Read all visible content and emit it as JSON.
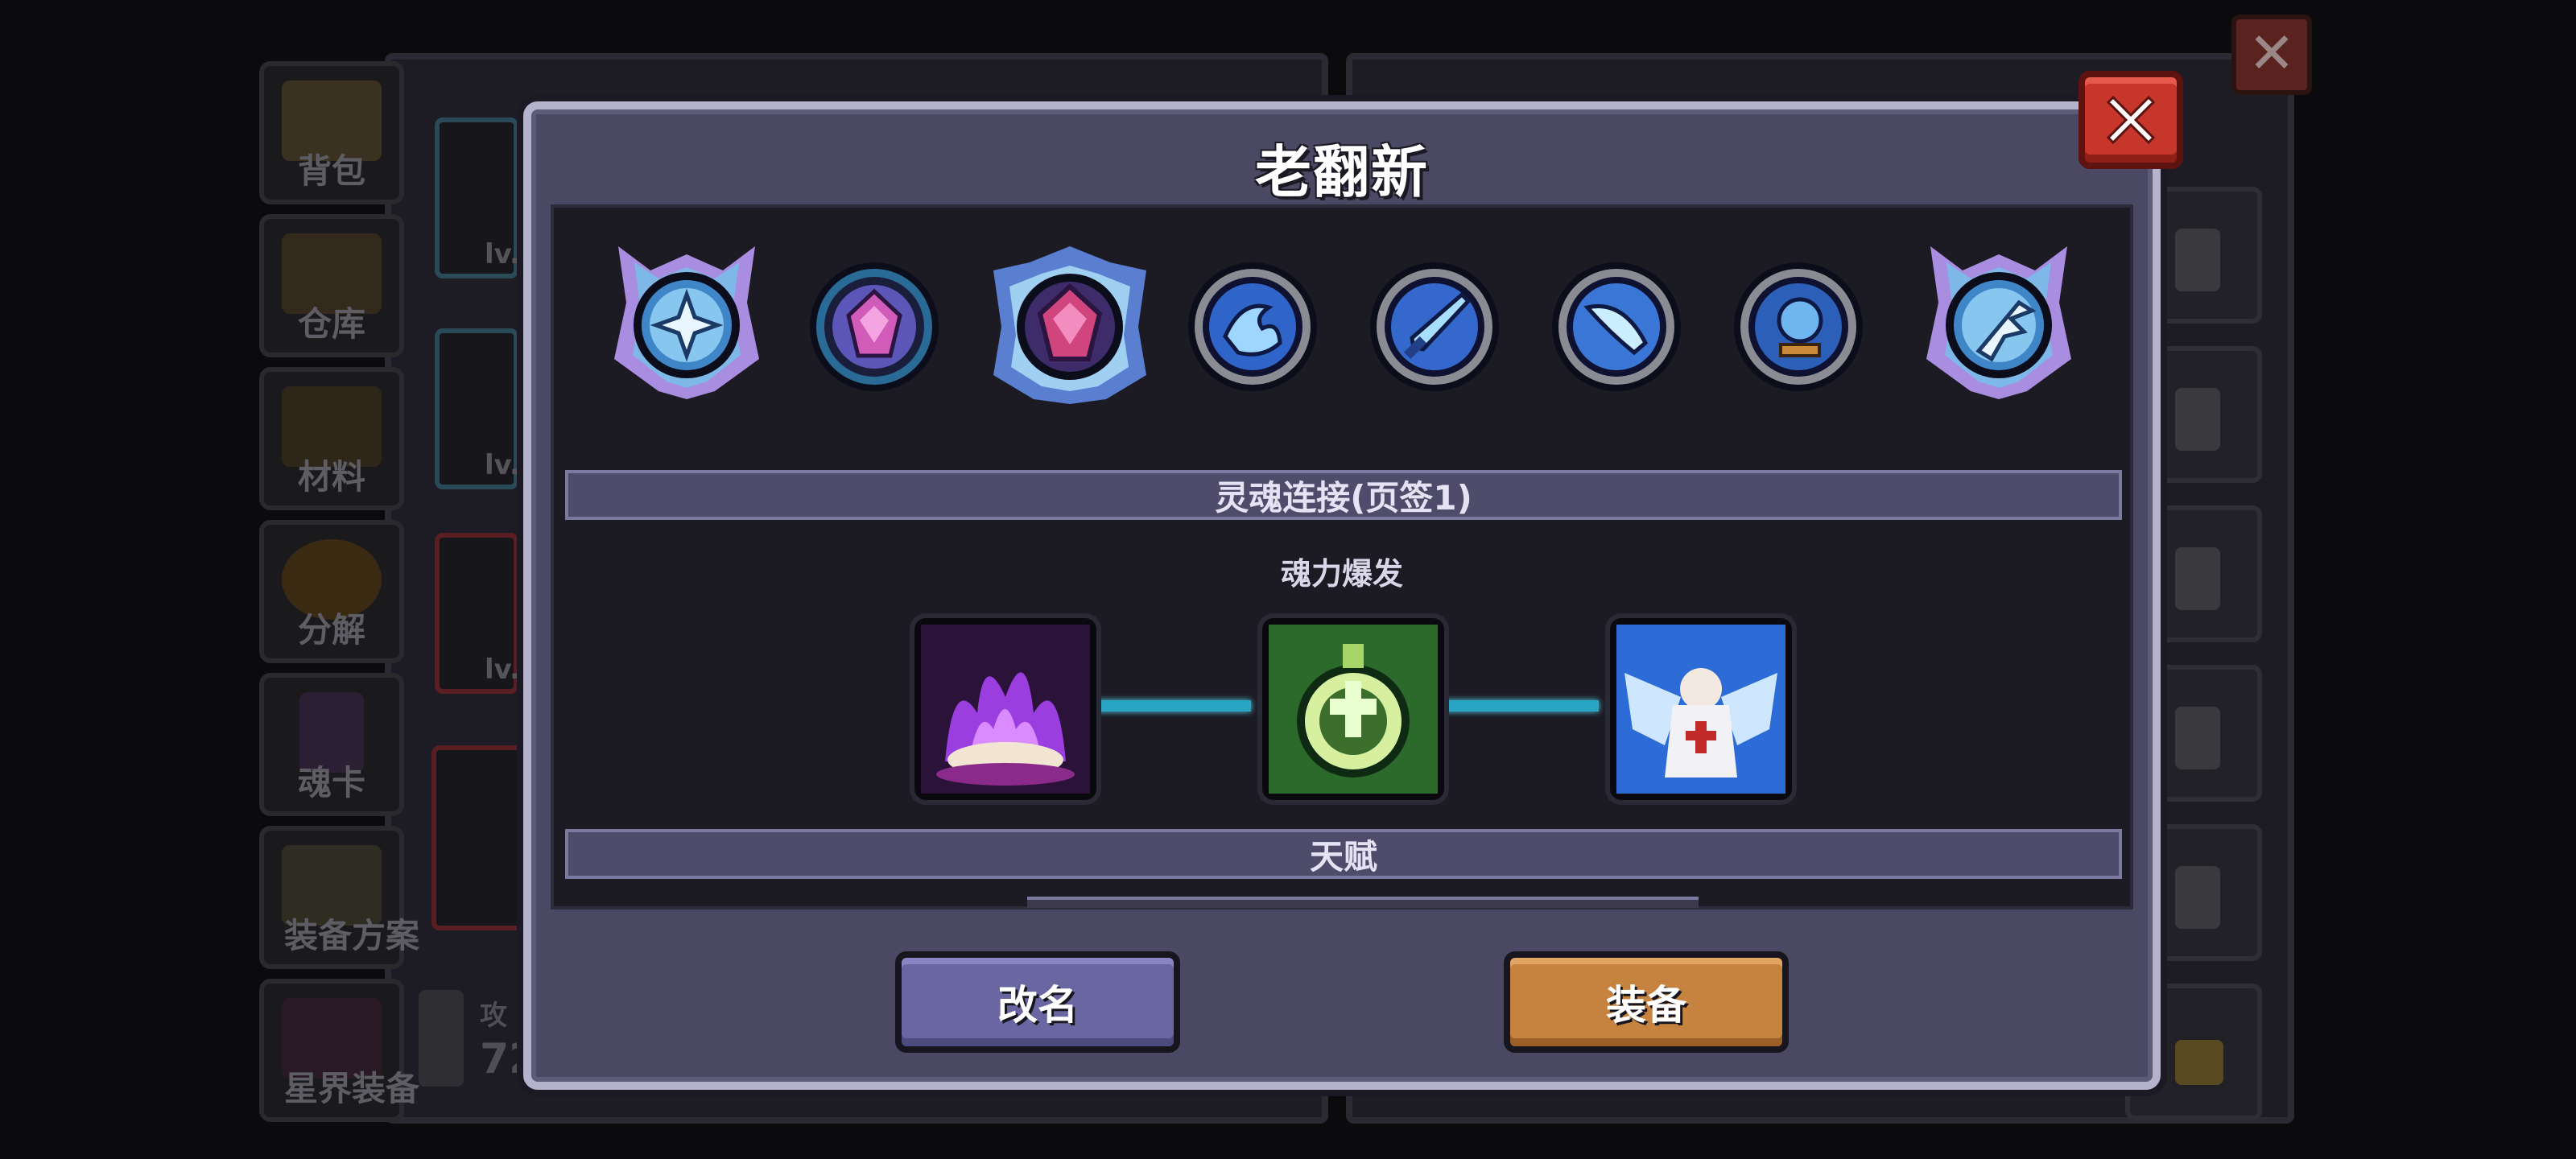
{
  "side_nav": [
    {
      "label": "背包"
    },
    {
      "label": "仓库"
    },
    {
      "label": "材料"
    },
    {
      "label": "分解"
    },
    {
      "label": "魂卡"
    },
    {
      "label": "装备方案"
    },
    {
      "label": "星界装备"
    }
  ],
  "cards": [
    {
      "lv": "lv."
    },
    {
      "lv": "lv."
    },
    {
      "lv": "lv."
    }
  ],
  "attack": {
    "label": "攻",
    "value": "72"
  },
  "modal": {
    "title": "老翻新",
    "close_label": "×",
    "section_soul": "灵魂连接(页签1)",
    "soul_link_name": "魂力爆发",
    "section_talent": "天赋",
    "rename_button": "改名",
    "equip_button": "装备"
  },
  "gems": [
    {
      "icon": "cross-shield-gem-icon",
      "size": "big"
    },
    {
      "icon": "pink-crystal-gem-icon",
      "size": "small"
    },
    {
      "icon": "pink-crystal-winged-gem-icon",
      "size": "big"
    },
    {
      "icon": "blue-wave-gem-icon",
      "size": "small"
    },
    {
      "icon": "blue-sword-gem-icon",
      "size": "small"
    },
    {
      "icon": "blue-feather-gem-icon",
      "size": "small"
    },
    {
      "icon": "blue-orb-gem-icon",
      "size": "small"
    },
    {
      "icon": "blue-axe-gem-icon",
      "size": "big"
    }
  ],
  "soul_cards": [
    {
      "icon": "purple-flame-card-icon"
    },
    {
      "icon": "green-cross-card-icon"
    },
    {
      "icon": "blue-angel-card-icon"
    }
  ],
  "colors": {
    "modal_bg": "#4a4862",
    "modal_border": "#b5b2cb",
    "close_red": "#c7362b",
    "rename_purple": "#6a66a2",
    "equip_orange": "#c6833f",
    "link_cyan": "#2aa6c4"
  }
}
